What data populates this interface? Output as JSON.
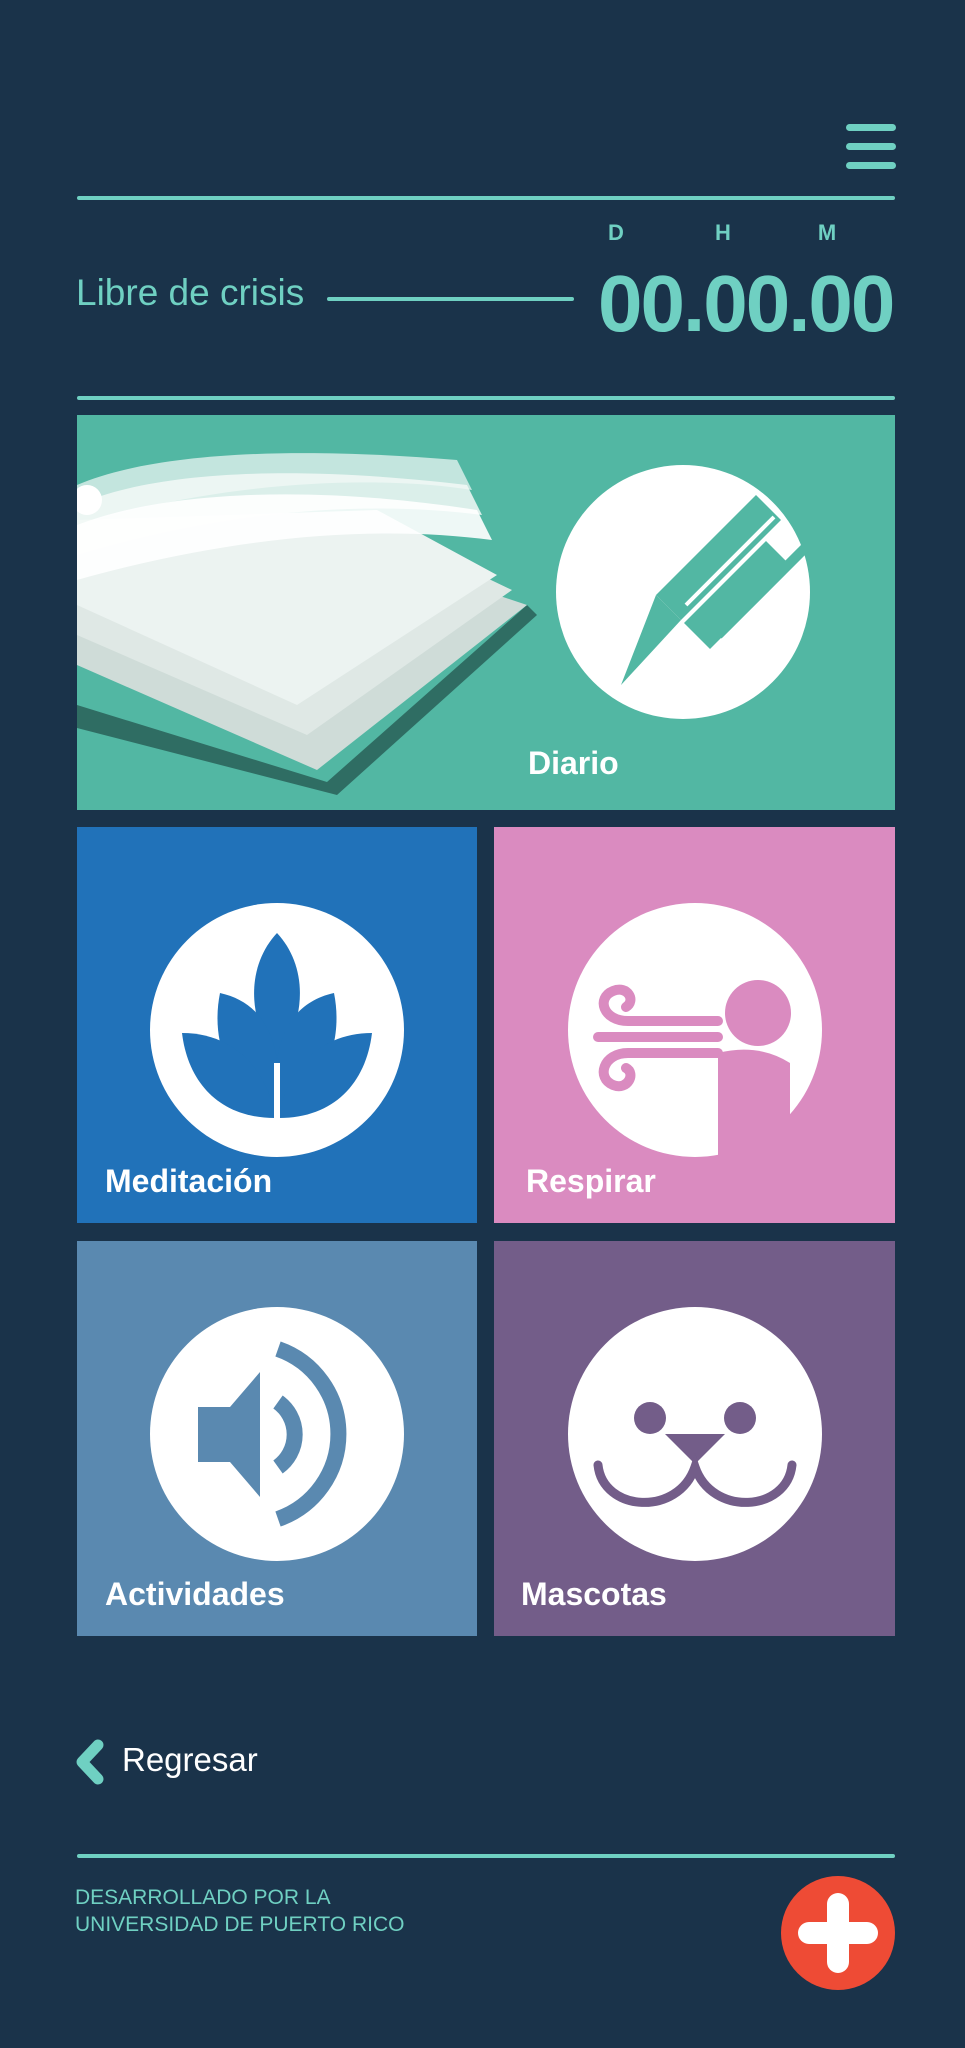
{
  "header": {
    "menu_icon": "hamburger-menu-icon"
  },
  "timer": {
    "label": "Libre de crisis",
    "units": {
      "days": "D",
      "hours": "H",
      "minutes": "M"
    },
    "value": "00.00.00"
  },
  "tiles": {
    "diario": {
      "label": "Diario",
      "color": "#52b7a3",
      "icon": "pencil-icon"
    },
    "meditacion": {
      "label": "Meditación",
      "color": "#2172b9",
      "icon": "lotus-icon"
    },
    "respirar": {
      "label": "Respirar",
      "color": "#da8bc0",
      "icon": "breath-icon"
    },
    "actividades": {
      "label": "Actividades",
      "color": "#5a89b0",
      "icon": "speaker-icon"
    },
    "mascotas": {
      "label": "Mascotas",
      "color": "#735d89",
      "icon": "seal-icon"
    }
  },
  "navigation": {
    "back_label": "Regresar"
  },
  "footer": {
    "credit_line1": "DESARROLLADO POR LA",
    "credit_line2": "UNIVERSIDAD DE PUERTO RICO",
    "emergency_icon": "plus-icon"
  },
  "colors": {
    "background": "#1a334a",
    "accent": "#6fd0c2",
    "emergency": "#ee4b35"
  }
}
